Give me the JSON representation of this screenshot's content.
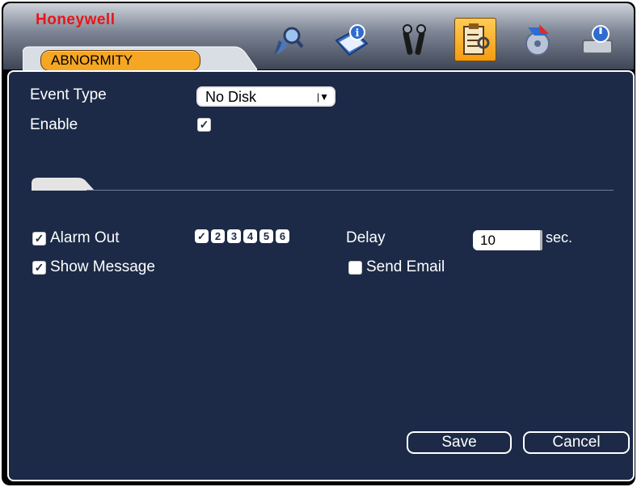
{
  "header": {
    "brand": "Honeywell",
    "active_tab": "ABNORMITY",
    "icons": [
      "search-icon",
      "info-book-icon",
      "tools-icon",
      "advanced-clipboard-icon",
      "backup-disk-icon",
      "shutdown-icon"
    ],
    "active_icon": "advanced-clipboard-icon"
  },
  "form": {
    "event_type_label": "Event Type",
    "event_type_value": "No Disk",
    "enable_label": "Enable",
    "enable_checked": true,
    "alarm_out_label": "Alarm Out",
    "alarm_out_checked": true,
    "alarm_channels": [
      {
        "label": "1",
        "checked": true
      },
      {
        "label": "2",
        "checked": false
      },
      {
        "label": "3",
        "checked": false
      },
      {
        "label": "4",
        "checked": false
      },
      {
        "label": "5",
        "checked": false
      },
      {
        "label": "6",
        "checked": false
      }
    ],
    "delay_label": "Delay",
    "delay_value": "10",
    "delay_unit": "sec.",
    "show_message_label": "Show Message",
    "show_message_checked": true,
    "send_email_label": "Send Email",
    "send_email_checked": false
  },
  "buttons": {
    "save": "Save",
    "cancel": "Cancel"
  },
  "colors": {
    "panel_bg": "#1c2a47",
    "tab_orange": "#f5a623",
    "brand_red": "#e6161c"
  }
}
